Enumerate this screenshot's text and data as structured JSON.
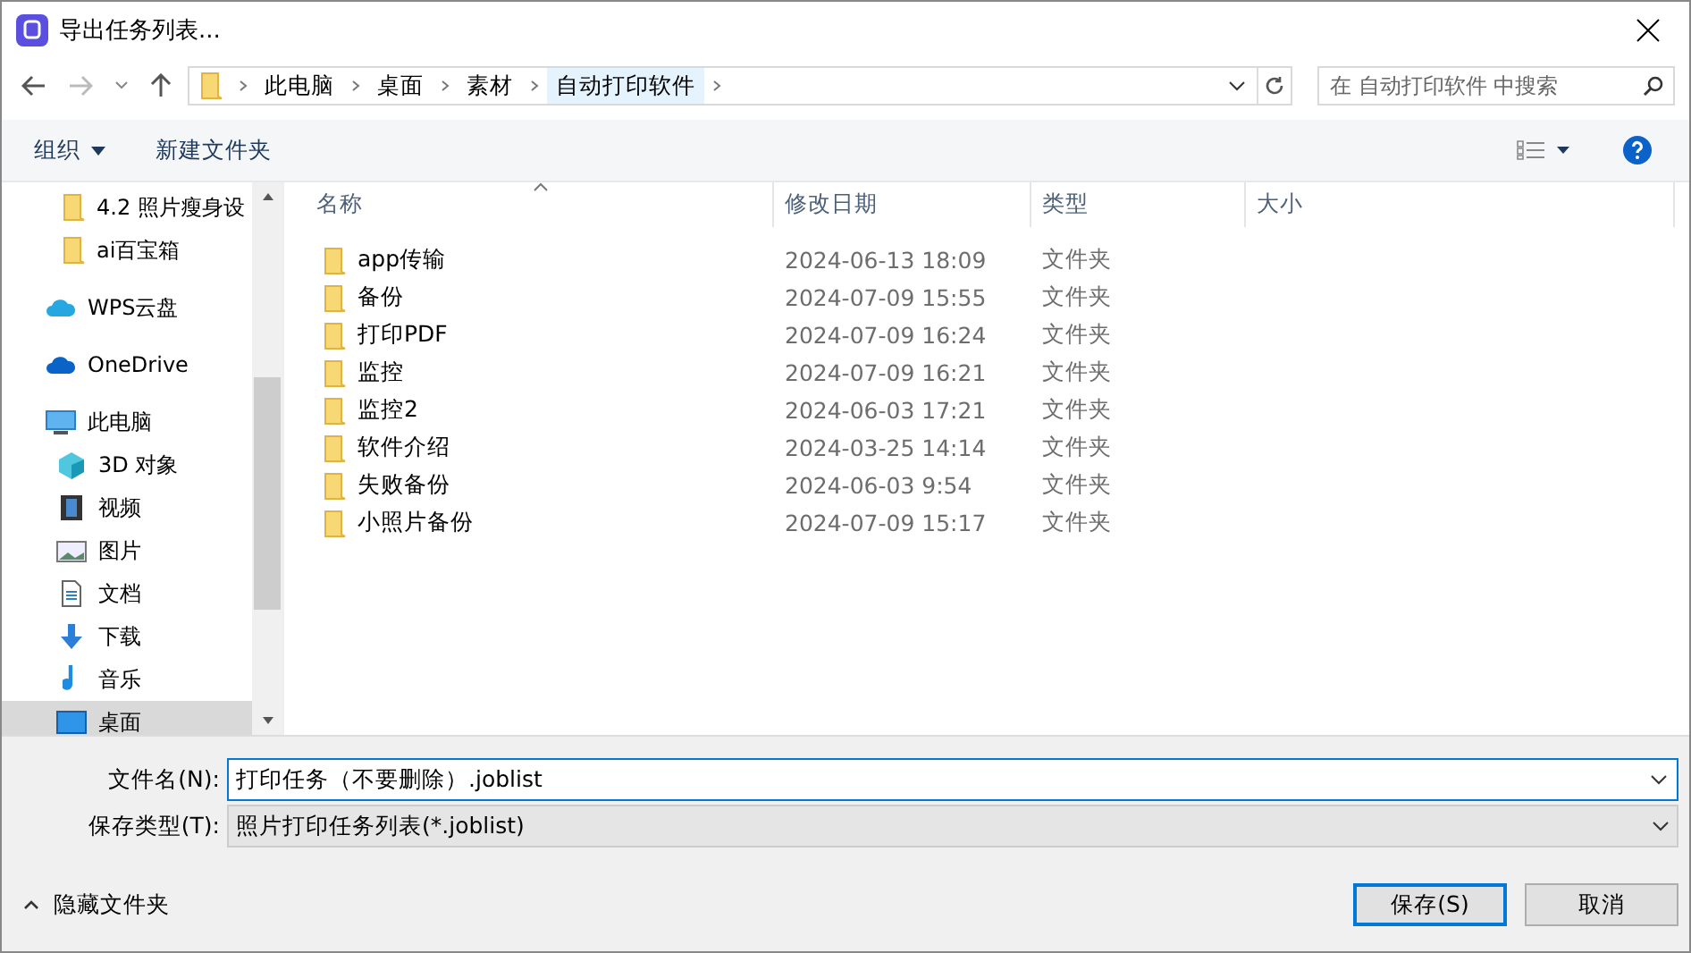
{
  "window": {
    "title": "导出任务列表..."
  },
  "address": {
    "crumbs": [
      "此电脑",
      "桌面",
      "素材",
      "自动打印软件"
    ],
    "search_placeholder": "在 自动打印软件 中搜索"
  },
  "toolbar": {
    "organize": "组织",
    "new_folder": "新建文件夹"
  },
  "sidebar": {
    "items": [
      {
        "label": "4.2 照片瘦身设",
        "kind": "folder",
        "selected": false
      },
      {
        "label": "ai百宝箱",
        "kind": "folder",
        "selected": false
      },
      {
        "label": "WPS云盘",
        "kind": "cloud",
        "selected": false
      },
      {
        "label": "OneDrive",
        "kind": "cloud",
        "selected": false
      },
      {
        "label": "此电脑",
        "kind": "pc",
        "selected": false,
        "children": [
          {
            "label": "3D 对象",
            "kind": "cube",
            "selected": false
          },
          {
            "label": "视频",
            "kind": "video",
            "selected": false
          },
          {
            "label": "图片",
            "kind": "picture",
            "selected": false
          },
          {
            "label": "文档",
            "kind": "document",
            "selected": false
          },
          {
            "label": "下载",
            "kind": "download",
            "selected": false
          },
          {
            "label": "音乐",
            "kind": "music",
            "selected": false
          },
          {
            "label": "桌面",
            "kind": "desktop",
            "selected": true
          }
        ]
      }
    ]
  },
  "table": {
    "columns": [
      "名称",
      "修改日期",
      "类型",
      "大小"
    ],
    "rows": [
      {
        "name": "app传输",
        "date": "2024-06-13 18:09",
        "type": "文件夹"
      },
      {
        "name": "备份",
        "date": "2024-07-09 15:55",
        "type": "文件夹"
      },
      {
        "name": "打印PDF",
        "date": "2024-07-09 16:24",
        "type": "文件夹"
      },
      {
        "name": "监控",
        "date": "2024-07-09 16:21",
        "type": "文件夹"
      },
      {
        "name": "监控2",
        "date": "2024-06-03 17:21",
        "type": "文件夹"
      },
      {
        "name": "软件介绍",
        "date": "2024-03-25 14:14",
        "type": "文件夹"
      },
      {
        "name": "失败备份",
        "date": "2024-06-03 9:54",
        "type": "文件夹"
      },
      {
        "name": "小照片备份",
        "date": "2024-07-09 15:17",
        "type": "文件夹"
      }
    ]
  },
  "form": {
    "filename_label": "文件名(N):",
    "filename": "打印任务（不要删除）.joblist",
    "type_label": "保存类型(T):",
    "type": "照片打印任务列表(*.joblist)"
  },
  "footer": {
    "hide_folders": "隐藏文件夹",
    "save": "保存(S)",
    "cancel": "取消"
  }
}
